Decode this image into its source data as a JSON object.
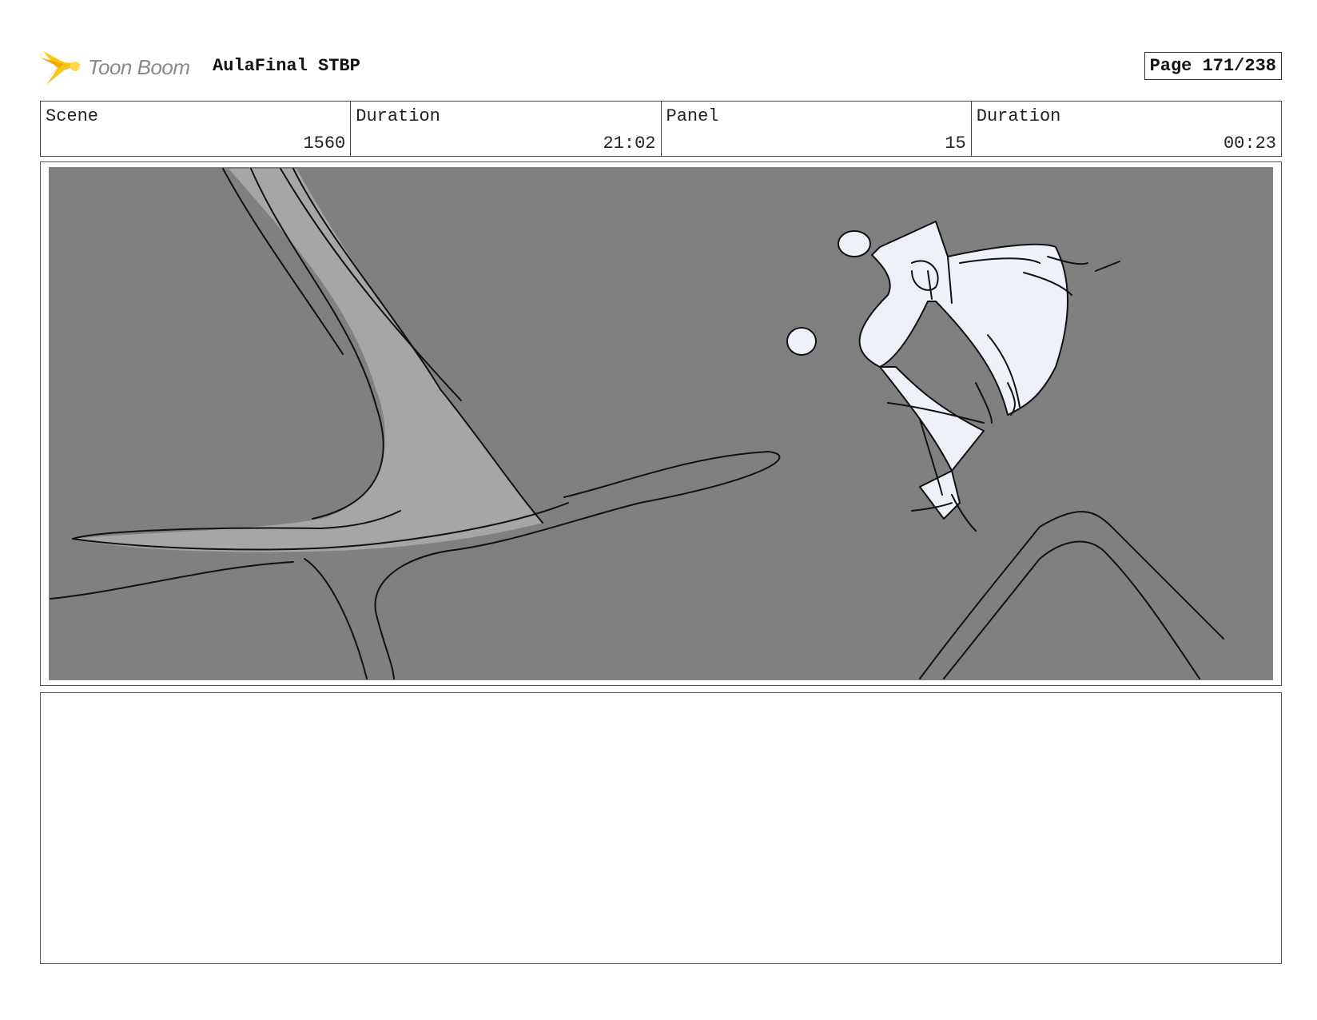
{
  "header": {
    "logo_text": "Toon Boom",
    "project_title": "AulaFinal STBP",
    "page_label": "Page 171/238"
  },
  "info": {
    "scene_label": "Scene",
    "scene_value": "1560",
    "scene_duration_label": "Duration",
    "scene_duration_value": "21:02",
    "panel_label": "Panel",
    "panel_value": "15",
    "panel_duration_label": "Duration",
    "panel_duration_value": "00:23"
  },
  "colors": {
    "logo_accent": "#f5c518",
    "panel_background": "#808080",
    "structure_fill": "#a6a6a6",
    "character_fill": "#eef1f8"
  },
  "notes": {
    "text": ""
  }
}
